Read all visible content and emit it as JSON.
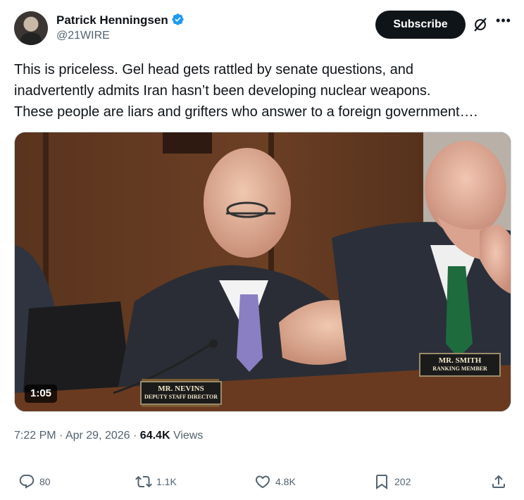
{
  "author": {
    "display_name": "Patrick Henningsen",
    "handle": "@21WIRE",
    "verified_icon": "verified-badge-icon",
    "accent_color": "#1d9bf0"
  },
  "header": {
    "subscribe_label": "Subscribe",
    "grok_icon": "grok-icon",
    "more_icon": "more-options-icon"
  },
  "tweet": {
    "lines": [
      "This is priceless. Gel head gets rattled by senate questions, and",
      "inadvertently admits Iran hasn’t been developing nuclear weapons.",
      "These people are liars and grifters who answer to a foreign government…."
    ]
  },
  "media": {
    "duration": "1:05",
    "nameplate_left": {
      "line1": "MR. NEVINS",
      "line2": "DEPUTY STAFF DIRECTOR"
    },
    "nameplate_right": {
      "line1": "MR. SMITH",
      "line2": "RANKING MEMBER"
    }
  },
  "meta": {
    "time": "7:22 PM",
    "separator": "·",
    "date": "Apr 29, 2026",
    "views_count": "64.4K",
    "views_label": "Views"
  },
  "actions": {
    "replies": "80",
    "reposts": "1.1K",
    "likes": "4.8K",
    "bookmarks": "202"
  }
}
